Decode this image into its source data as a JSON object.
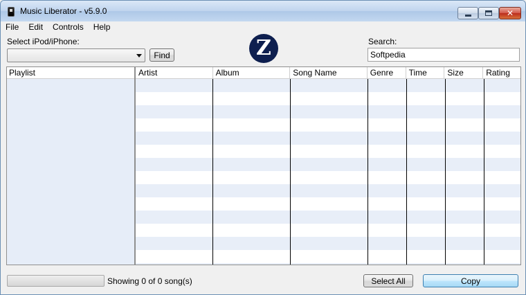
{
  "window": {
    "title": "Music Liberator - v5.9.0"
  },
  "menu": [
    "File",
    "Edit",
    "Controls",
    "Help"
  ],
  "device": {
    "label": "Select iPod/iPhone:",
    "selected": "",
    "find_label": "Find"
  },
  "logo": {
    "letter": "Z",
    "color": "#0e1f4f"
  },
  "search": {
    "label": "Search:",
    "value": "Softpedia"
  },
  "playlist": {
    "header": "Playlist"
  },
  "table": {
    "columns": [
      "Artist",
      "Album",
      "Song Name",
      "Genre",
      "Time",
      "Size",
      "Rating"
    ],
    "rows": []
  },
  "status": {
    "text": "Showing 0 of 0 song(s)",
    "progress": 0
  },
  "buttons": {
    "select_all": "Select All",
    "copy": "Copy"
  },
  "icons": {
    "app": "ipod-icon",
    "minimize": "minimize-icon",
    "maximize": "maximize-icon",
    "close": "close-icon",
    "dropdown": "chevron-down-icon"
  }
}
